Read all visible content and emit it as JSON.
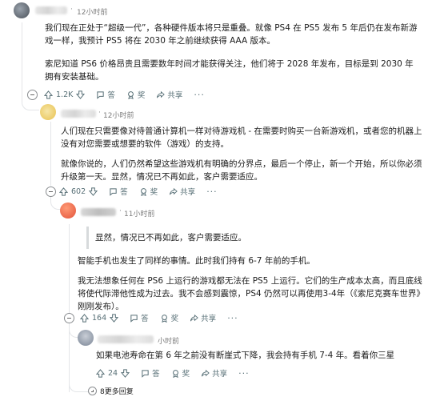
{
  "comments": [
    {
      "time": "12小时前",
      "paragraphs": [
        "我们现在正处于“超级一代”，各种硬件版本将只是重叠。就像 PS4 在 PS5 发布 5 年后仍在发布新游戏一样，我预计 PS5 将在 2030 年之前继续获得 AAA 版本。",
        "索尼知道 PS6 价格昂贵且需要数年时间才能获得关注，他们将于 2028 年发布，目标是到 2030 年拥有安装基础。"
      ],
      "votes": "1.2K",
      "reply_label": "答",
      "award_label": "奖",
      "share_label": "共享"
    },
    {
      "time": "12小时前",
      "paragraphs": [
        "人们现在只需要像对待普通计算机一样对待游戏机 - 在需要时购买一台新游戏机，或者您的机器上没有对您需要或想要的软件（游戏）的支持。",
        "就像你说的，人们仍然希望这些游戏机有明确的分界点，最后一个停止，新一个开始，所以你必须升级第一天。显然，情况已不再如此，客户需要适应。"
      ],
      "votes": "602",
      "reply_label": "答",
      "award_label": "奖",
      "share_label": "共享"
    },
    {
      "time": "11小时前",
      "quote": "显然，情况已不再如此，客户需要适应。",
      "paragraphs": [
        "智能手机也发生了同样的事情。此时我们持有 6-7 年前的手机。",
        "我无法想象任何在 PS6 上运行的游戏都无法在 PS5 上运行。它们的生产成本太高，而且底线将使代际滞他性成为过去。我不会感到震惊，PS4 仍然可以再使用3-4年（《索尼克赛车世界》刚刚发布）。"
      ],
      "votes": "164",
      "reply_label": "答",
      "award_label": "奖",
      "share_label": "共享"
    },
    {
      "time": "小时前",
      "paragraphs": [
        "如果电池寿命在第 6 年之前没有断崖式下降，我会持有手机 7-4 年。看着你三星"
      ],
      "votes": "24",
      "reply_label": "答",
      "award_label": "奖",
      "share_label": "共享"
    }
  ],
  "more_replies": "8更多回复",
  "more_dots": "···"
}
